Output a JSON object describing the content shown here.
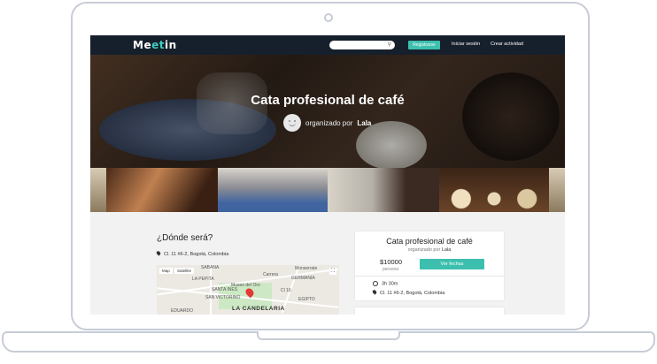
{
  "brand": {
    "logo_pre": "Me",
    "logo_accent": "et",
    "logo_post": "in"
  },
  "nav": {
    "search_placeholder": "",
    "register_label": "Registrarse",
    "login_label": "Iniciar sesión",
    "create_label": "Crear actividad"
  },
  "hero": {
    "title": "Cata profesional de café",
    "organizer_prefix": "organizado por",
    "organizer_name": "Lala"
  },
  "location": {
    "heading": "¿Dónde será?",
    "address": "Cl. 11 #6-2, Bogotá, Colombia",
    "map": {
      "map_tab": "Map",
      "satellite_tab": "Satellite",
      "streets": [
        "SABANA",
        "LA PEPITA",
        "SANTA INES",
        "SAN VICTORINO",
        "EDUARDO",
        "GERMANIA",
        "EGIPTO",
        "LA CANDELARIA",
        "Monserrate",
        "Museo del Oro",
        "Carrera",
        "Cl 16"
      ]
    }
  },
  "card": {
    "title": "Cata profesional de café",
    "organizer_prefix": "organizado por",
    "organizer_name": "Lala",
    "price": "$10000",
    "price_unit": "persona",
    "dates_button": "Ver fechas",
    "duration": "3h 30m",
    "address": "Cl. 11 #6-2, Bogotá, Colombia"
  },
  "colors": {
    "navbar": "#16202c",
    "accent": "#3cbfae",
    "page_bg": "#f2f2f2"
  },
  "icons": [
    "search-icon",
    "location-pin-icon",
    "clock-icon",
    "fullscreen-icon",
    "map-marker-icon",
    "avatar"
  ]
}
